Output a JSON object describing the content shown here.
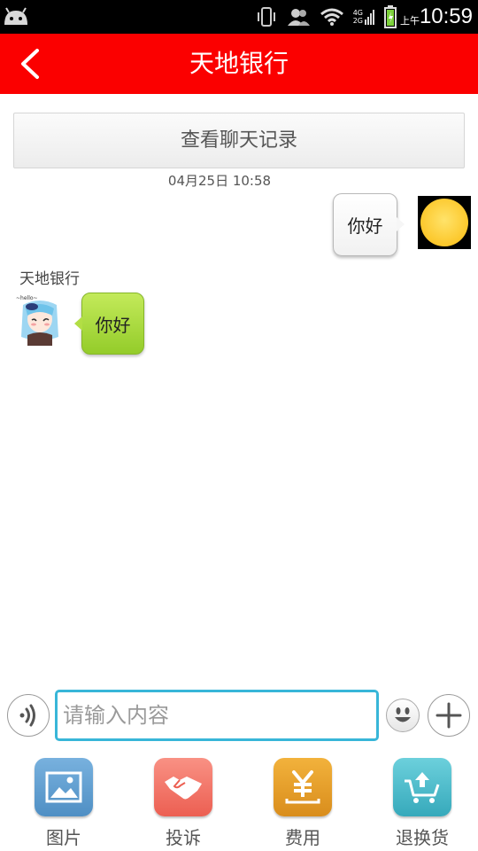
{
  "status_bar": {
    "network_top": "4G",
    "network_bottom": "2G",
    "ampm": "上午",
    "time": "10:59"
  },
  "header": {
    "title": "天地银行",
    "background_color": "#fb0000"
  },
  "chat": {
    "history_button_label": "查看聊天记录",
    "timestamp": "04月25日 10:58",
    "messages": [
      {
        "side": "right",
        "text": "你好",
        "avatar": "sun-avatar",
        "bubble_color": "#ffffff"
      },
      {
        "side": "left",
        "sender": "天地银行",
        "text": "你好",
        "avatar": "anime-girl-avatar",
        "bubble_color": "#a8d93c"
      }
    ]
  },
  "input_bar": {
    "placeholder": "请输入内容",
    "value": "",
    "focus_color": "#38b6d8"
  },
  "tools": [
    {
      "label": "图片",
      "icon": "picture-icon",
      "color": "#5b9bd0"
    },
    {
      "label": "投诉",
      "icon": "handshake-icon",
      "color": "#f26f60"
    },
    {
      "label": "费用",
      "icon": "yuan-icon",
      "color": "#e8a12a"
    },
    {
      "label": "退换货",
      "icon": "cart-return-icon",
      "color": "#45b8c8"
    }
  ]
}
